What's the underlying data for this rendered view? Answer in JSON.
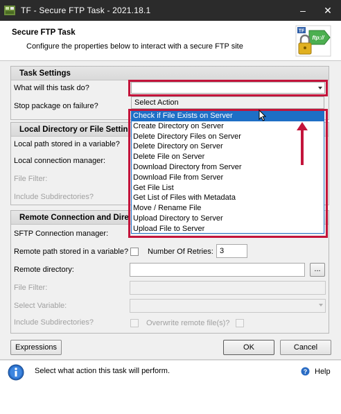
{
  "window": {
    "title": "TF - Secure FTP Task - 2021.18.1",
    "minimize": "–",
    "close": "✕"
  },
  "header": {
    "title": "Secure FTP Task",
    "subtitle": "Configure the properties below to interact with a secure FTP site",
    "logo_text": "ftp://",
    "logo_badge": "TF"
  },
  "task_settings": {
    "heading": "Task Settings",
    "action_label": "What will this task do?",
    "stop_label": "Stop package on failure?"
  },
  "local": {
    "heading": "Local Directory or File Settin",
    "path_var_label": "Local path stored in a variable?",
    "conn_label": "Local connection manager:",
    "filter_label": "File Filter:",
    "subdirs_label": "Include Subdirectories?"
  },
  "remote": {
    "heading": "Remote Connection and Dire",
    "sftp_label": "SFTP Connection manager:",
    "path_var_label": "Remote path stored in a variable?",
    "retries_label": "Number Of Retries:",
    "retries_value": "3",
    "dir_label": "Remote directory:",
    "browse": "...",
    "filter_label": "File Filter:",
    "select_var_label": "Select Variable:",
    "subdirs_label": "Include Subdirectories?",
    "overwrite_label": "Overwrite remote file(s)?"
  },
  "dropdown": {
    "header": "Select Action",
    "items": [
      "Check if File Exists on Server",
      "Create Directory on Server",
      "Delete Directory Files on Server",
      "Delete Directory on Server",
      "Delete File on Server",
      "Download Directory from Server",
      "Download File from Server",
      "Get File List",
      "Get List of Files with Metadata",
      "Move / Rename File",
      "Upload Directory to Server",
      "Upload File to Server"
    ],
    "selected_index": 0
  },
  "buttons": {
    "expressions": "Expressions",
    "ok": "OK",
    "cancel": "Cancel"
  },
  "status": {
    "message": "Select what action this task will perform.",
    "help": "Help"
  },
  "colors": {
    "highlight": "#c3143b",
    "selection": "#1e6fc6"
  }
}
